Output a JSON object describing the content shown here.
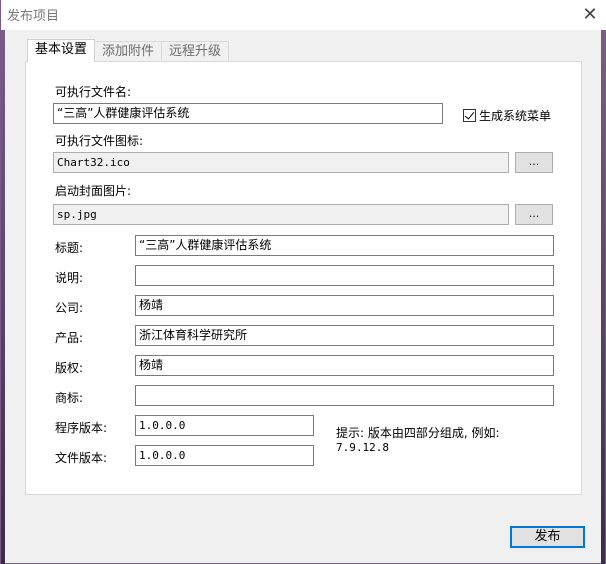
{
  "window": {
    "title": "发布项目",
    "close_glyph": "✕"
  },
  "tabs": [
    {
      "label": "基本设置",
      "active": true
    },
    {
      "label": "添加附件",
      "active": false
    },
    {
      "label": "远程升级",
      "active": false
    }
  ],
  "form": {
    "exe_name_label": "可执行文件名:",
    "exe_name_value": "“三高”人群健康评估系统",
    "create_menu_label": "生成系统菜单",
    "create_menu_checked": true,
    "exe_icon_label": "可执行文件图标:",
    "exe_icon_value": "Chart32.ico",
    "splash_label": "启动封面图片:",
    "splash_value": "sp.jpg",
    "browse_label": "...",
    "title_label": "标题:",
    "title_value": "“三高”人群健康评估系统",
    "description_label": "说明:",
    "description_value": "",
    "company_label": "公司:",
    "company_value": "杨靖",
    "product_label": "产品:",
    "product_value": "浙江体育科学研究所",
    "copyright_label": "版权:",
    "copyright_value": "杨靖",
    "trademark_label": "商标:",
    "trademark_value": "",
    "program_version_label": "程序版本:",
    "program_version_value": "1.0.0.0",
    "file_version_label": "文件版本:",
    "file_version_value": "1.0.0.0",
    "hint_line1": "提示: 版本由四部分组成, 例如:",
    "hint_line2": "7.9.12.8"
  },
  "buttons": {
    "publish_label": "发布"
  },
  "colors": {
    "accent": "#0078d7",
    "panel_bg": "#ffffff",
    "dialog_bg": "#f0f0f0"
  },
  "icons": {
    "close": "close-icon",
    "checkbox": "checkbox-checked-icon"
  }
}
